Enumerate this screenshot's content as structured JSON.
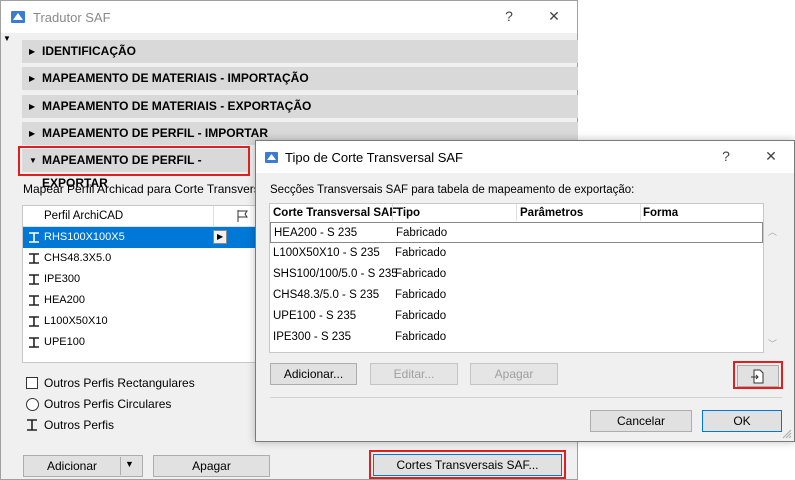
{
  "main_window": {
    "title": "Tradutor SAF",
    "help_label": "?",
    "close_label": "✕",
    "sections": [
      {
        "label": "IDENTIFICAÇÃO",
        "expanded": false
      },
      {
        "label": "MAPEAMENTO DE MATERIAIS - IMPORTAÇÃO",
        "expanded": false
      },
      {
        "label": "MAPEAMENTO DE MATERIAIS - EXPORTAÇÃO",
        "expanded": false
      },
      {
        "label": "MAPEAMENTO DE PERFIL - IMPORTAR",
        "expanded": false
      },
      {
        "label": "MAPEAMENTO DE PERFIL - EXPORTAR",
        "expanded": true
      }
    ],
    "map_label": "Mapear Perfil Archicad para Corte Transversal",
    "profile_list": {
      "header": "Perfil ArchiCAD",
      "items": [
        "RHS100X100X5",
        "CHS48.3X5.0",
        "IPE300",
        "HEA200",
        "L100X50X10",
        "UPE100"
      ],
      "selected_index": 0
    },
    "options": {
      "rect": "Outros Perfis Rectangulares",
      "circ": "Outros Perfis Circulares",
      "other": "Outros Perfis"
    },
    "buttons": {
      "add": "Adicionar",
      "delete": "Apagar",
      "cortes": "Cortes Transversais SAF..."
    }
  },
  "dialog": {
    "title": "Tipo de Corte Transversal SAF",
    "help_label": "?",
    "close_label": "✕",
    "description": "Secções Transversais SAF para tabela de mapeamento de exportação:",
    "columns": [
      "Corte Transversal SAF",
      "Tipo",
      "Parâmetros",
      "Forma"
    ],
    "rows": [
      {
        "name": "HEA200 - S 235",
        "type": "Fabricado"
      },
      {
        "name": "L100X50X10 - S 235",
        "type": "Fabricado"
      },
      {
        "name": "SHS100/100/5.0 - S 235",
        "type": "Fabricado"
      },
      {
        "name": "CHS48.3/5.0 - S 235",
        "type": "Fabricado"
      },
      {
        "name": "UPE100 - S 235",
        "type": "Fabricado"
      },
      {
        "name": "IPE300 - S 235",
        "type": "Fabricado"
      }
    ],
    "buttons": {
      "add": "Adicionar...",
      "edit": "Editar...",
      "delete": "Apagar",
      "cancel": "Cancelar",
      "ok": "OK"
    }
  },
  "colors": {
    "highlight": "#e02020",
    "selection": "#0078d7"
  }
}
